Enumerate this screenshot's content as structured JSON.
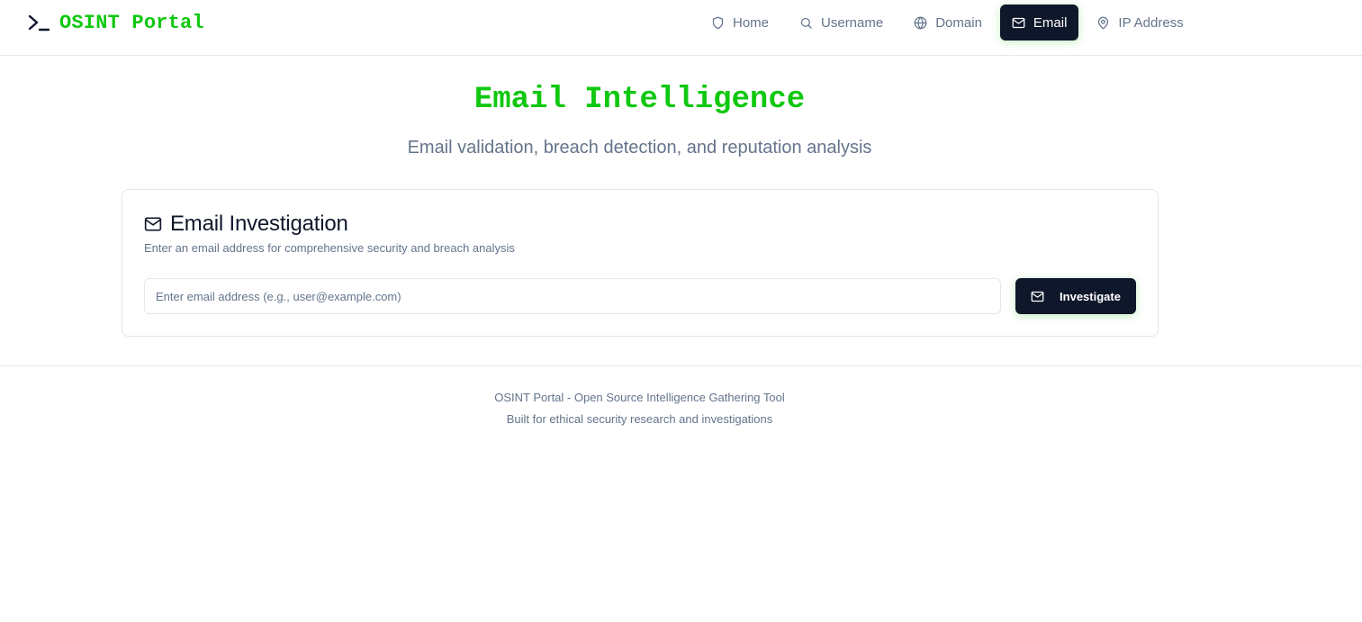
{
  "header": {
    "brand": {
      "icon": "terminal-icon",
      "title": "OSINT Portal"
    },
    "nav": [
      {
        "label": "Home",
        "icon": "shield-icon",
        "active": false
      },
      {
        "label": "Username",
        "icon": "search-icon",
        "active": false
      },
      {
        "label": "Domain",
        "icon": "globe-icon",
        "active": false
      },
      {
        "label": "Email",
        "icon": "mail-icon",
        "active": true
      },
      {
        "label": "IP Address",
        "icon": "map-pin-icon",
        "active": false
      }
    ]
  },
  "hero": {
    "title": "Email Intelligence",
    "subtitle": "Email validation, breach detection, and reputation analysis"
  },
  "card": {
    "icon": "mail-icon",
    "title": "Email Investigation",
    "description": "Enter an email address for comprehensive security and breach analysis",
    "input": {
      "value": "",
      "placeholder": "Enter email address (e.g., user@example.com)"
    },
    "button": {
      "icon": "mail-icon",
      "label": "Investigate"
    }
  },
  "footer": {
    "line1": "OSINT Portal - Open Source Intelligence Gathering Tool",
    "line2": "Built for ethical security research and investigations"
  },
  "colors": {
    "brand_green": "#10c810",
    "dark": "#0f172a",
    "muted": "#64748b",
    "border": "#e2e8f0"
  }
}
